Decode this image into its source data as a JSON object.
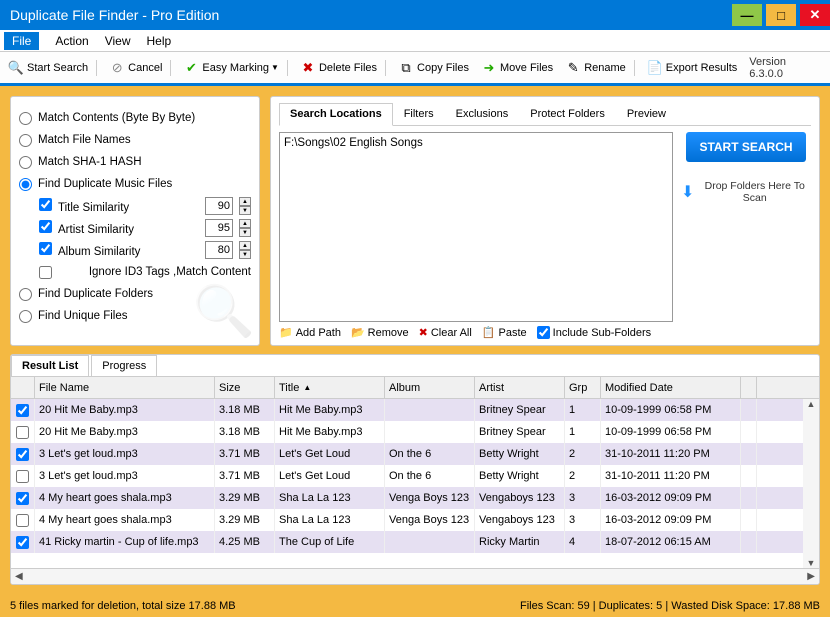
{
  "window": {
    "title": "Duplicate File Finder - Pro Edition"
  },
  "menu": {
    "file": "File",
    "action": "Action",
    "view": "View",
    "help": "Help"
  },
  "toolbar": {
    "start": "Start Search",
    "cancel": "Cancel",
    "easy": "Easy Marking",
    "delete": "Delete Files",
    "copy": "Copy Files",
    "move": "Move Files",
    "rename": "Rename",
    "export": "Export Results",
    "version": "Version 6.3.0.0"
  },
  "match": {
    "contents": "Match Contents (Byte By Byte)",
    "names": "Match File Names",
    "sha": "Match SHA-1 HASH",
    "music": "Find Duplicate Music Files",
    "title_sim": "Title Similarity",
    "title_val": "90",
    "artist_sim": "Artist Similarity",
    "artist_val": "95",
    "album_sim": "Album Similarity",
    "album_val": "80",
    "ignore": "Ignore ID3 Tags ,Match Content",
    "folders": "Find Duplicate Folders",
    "unique": "Find Unique Files"
  },
  "locs": {
    "tabs": {
      "locations": "Search Locations",
      "filters": "Filters",
      "exclusions": "Exclusions",
      "protect": "Protect Folders",
      "preview": "Preview"
    },
    "path0": "F:\\Songs\\02 English Songs",
    "start_btn": "START SEARCH",
    "drop_hint": "Drop Folders Here To Scan",
    "add": "Add Path",
    "remove": "Remove",
    "clear": "Clear All",
    "paste": "Paste",
    "sub": "Include Sub-Folders"
  },
  "result": {
    "tabs": {
      "list": "Result List",
      "progress": "Progress"
    },
    "headers": {
      "fname": "File Name",
      "size": "Size",
      "title": "Title",
      "album": "Album",
      "artist": "Artist",
      "grp": "Grp",
      "mdate": "Modified Date"
    },
    "rows": [
      {
        "checked": true,
        "fname": "20 Hit Me Baby.mp3",
        "size": "3.18 MB",
        "title": "Hit Me Baby.mp3",
        "album": "",
        "artist": "Britney Spear",
        "grp": "1",
        "mdate": "10-09-1999 06:58 PM"
      },
      {
        "checked": false,
        "fname": "20 Hit Me Baby.mp3",
        "size": "3.18 MB",
        "title": "Hit Me Baby.mp3",
        "album": "",
        "artist": "Britney Spear",
        "grp": "1",
        "mdate": "10-09-1999 06:58 PM"
      },
      {
        "checked": true,
        "fname": "3 Let's get loud.mp3",
        "size": "3.71 MB",
        "title": "Let's Get Loud",
        "album": "On the 6",
        "artist": "Betty Wright",
        "grp": "2",
        "mdate": "31-10-2011 11:20 PM"
      },
      {
        "checked": false,
        "fname": "3 Let's get loud.mp3",
        "size": "3.71 MB",
        "title": "Let's Get Loud",
        "album": "On the 6",
        "artist": "Betty Wright",
        "grp": "2",
        "mdate": "31-10-2011 11:20 PM"
      },
      {
        "checked": true,
        "fname": "4 My heart goes shala.mp3",
        "size": "3.29 MB",
        "title": "Sha La La 123",
        "album": "Venga Boys 123",
        "artist": "Vengaboys 123",
        "grp": "3",
        "mdate": "16-03-2012 09:09 PM"
      },
      {
        "checked": false,
        "fname": "4 My heart goes shala.mp3",
        "size": "3.29 MB",
        "title": "Sha La La 123",
        "album": "Venga Boys 123",
        "artist": "Vengaboys 123",
        "grp": "3",
        "mdate": "16-03-2012 09:09 PM"
      },
      {
        "checked": true,
        "fname": "41 Ricky martin - Cup of life.mp3",
        "size": "4.25 MB",
        "title": "The Cup of Life",
        "album": "",
        "artist": "Ricky Martin",
        "grp": "4",
        "mdate": "18-07-2012 06:15 AM"
      }
    ]
  },
  "status": {
    "left": "5 files marked for deletion, total size 17.88 MB",
    "right": "Files Scan: 59 | Duplicates: 5 | Wasted Disk Space: 17.88 MB"
  }
}
